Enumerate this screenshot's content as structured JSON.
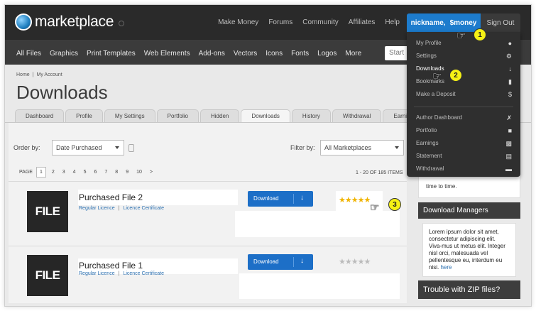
{
  "topbar": {
    "logo_text": "marketplace",
    "nav": [
      "Make Money",
      "Forums",
      "Community",
      "Affiliates",
      "Help"
    ],
    "account_name": "nickname,",
    "account_money": "$money",
    "sign_out": "Sign Out"
  },
  "subnav": {
    "items": [
      "All Files",
      "Graphics",
      "Print Templates",
      "Web Elements",
      "Add-ons",
      "Vectors",
      "Icons",
      "Fonts",
      "Logos",
      "More"
    ],
    "search_text": "Start"
  },
  "breadcrumb": [
    "Home",
    "|",
    "My Account"
  ],
  "page_title": "Downloads",
  "tabs": [
    "Dashboard",
    "Profile",
    "My Settings",
    "Portfolio",
    "Hidden",
    "Downloads",
    "History",
    "Withdrawal",
    "Earnings"
  ],
  "active_tab": "Downloads",
  "filters": {
    "order_label": "Order by:",
    "order_value": "Date Purchased",
    "filter_label": "Filter by:",
    "filter_value": "All Marketplaces"
  },
  "pager": {
    "label": "PAGE",
    "pages": [
      "1",
      "2",
      "3",
      "4",
      "5",
      "6",
      "7",
      "8",
      "9",
      "10",
      ">"
    ],
    "current": "1",
    "items_count": "1 - 20 OF 185 ITEMS"
  },
  "files": [
    {
      "tile": "FILE",
      "name": "Purchased File 2",
      "link1": "Regular Licence",
      "divider": "|",
      "link2": "Licence Certificate",
      "download_label": "Download",
      "rating": 5
    },
    {
      "tile": "FILE",
      "name": "Purchased File 1",
      "link1": "Regular Licence",
      "divider": "|",
      "link2": "Licence Certificate",
      "download_label": "Download",
      "rating": 0
    }
  ],
  "sidebar": {
    "snippet": "time to time.",
    "download_managers_title": "Download Managers",
    "download_managers_text": "Lorem ipsum dolor sit amet, consectetur adipiscing elit. Viva-mus ut metus elit. Integer nisl orci, malesuada vel pellentesque eu, interdum eu nisi.",
    "download_managers_link": "here",
    "zip_title": "Trouble with ZIP files?"
  },
  "dropdown": {
    "items": [
      {
        "label": "My Profile",
        "icon": "user-icon"
      },
      {
        "label": "Settings",
        "icon": "gear-icon"
      },
      {
        "label": "Downloads",
        "icon": "download-icon"
      },
      {
        "label": "Bookmarks",
        "icon": "bookmark-icon"
      },
      {
        "label": "Make a Deposit",
        "icon": "dollar-icon"
      },
      {
        "label": "Author Dashboard",
        "icon": "tools-icon"
      },
      {
        "label": "Portfolio",
        "icon": "briefcase-icon"
      },
      {
        "label": "Earnings",
        "icon": "bar-chart-icon"
      },
      {
        "label": "Statement",
        "icon": "document-icon"
      },
      {
        "label": "Withdrawal",
        "icon": "cash-icon"
      }
    ]
  },
  "steps": [
    "1",
    "2",
    "3"
  ],
  "colors": {
    "accent": "#1d7ccd",
    "badge": "#f5f115",
    "dark": "#2a2a2a"
  }
}
